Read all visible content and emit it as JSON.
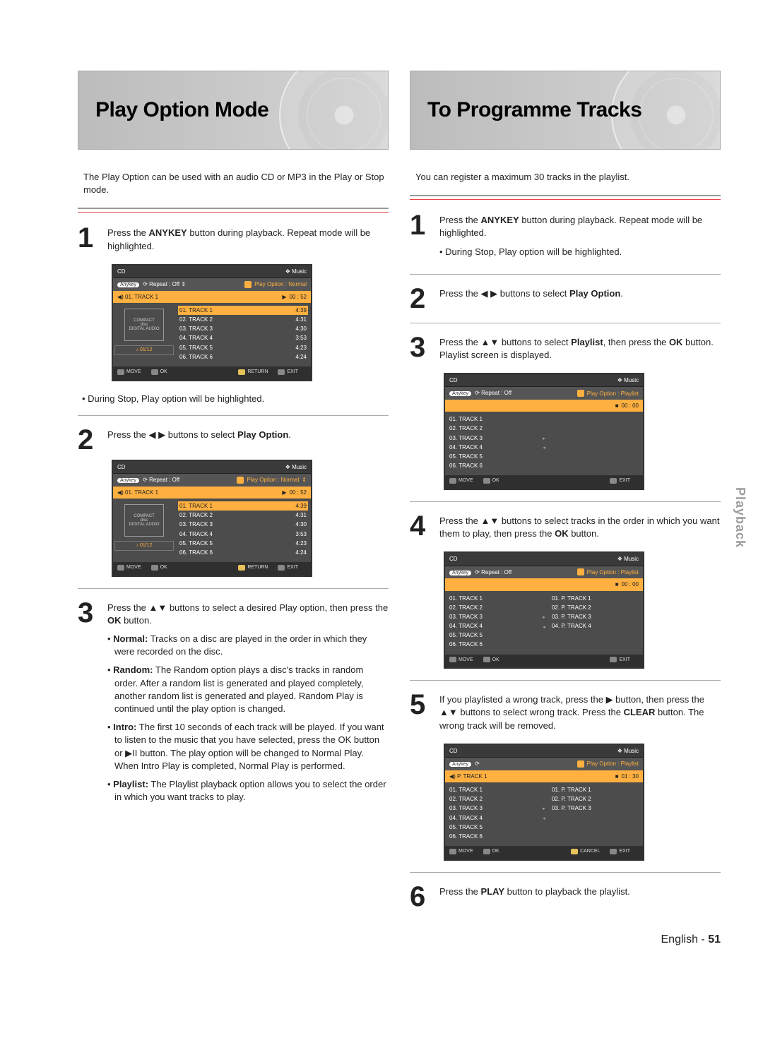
{
  "side_tab": "Playback",
  "footer": {
    "lang": "English -",
    "page": "51"
  },
  "left": {
    "title": "Play Option Mode",
    "intro": "The Play Option can be used with an audio CD or MP3 in the Play or Stop mode.",
    "step1": {
      "num": "1",
      "text_prefix": "Press the ",
      "anykey": "ANYKEY",
      "text_suffix": " button during playback. Repeat mode will be highlighted.",
      "note_prefix": "• During Stop, Play option will be highlighted."
    },
    "step2": {
      "num": "2",
      "text_prefix": "Press the ",
      "arrows": "◀ ▶",
      "text_mid": " buttons to select ",
      "playopt": "Play Option",
      "text_suffix": "."
    },
    "step3": {
      "num": "3",
      "text_prefix": "Press the ",
      "arrows": "▲▼",
      "text_mid": " buttons to select a desired Play option, then press the ",
      "ok": "OK",
      "text_suffix": " button.",
      "options": [
        {
          "name": "Normal:",
          "desc": "Tracks on a disc are played in the order in which they were recorded on the disc."
        },
        {
          "name": "Random:",
          "desc": "The Random option plays a disc's tracks in random order. After a random list is generated and played completely, another random list is generated and played. Random Play is continued until the play option is changed."
        },
        {
          "name": "Intro:",
          "desc": "The first 10 seconds of each track will be played. If you want to listen to the music that you have selected, press the OK button or ▶II button. The play option will be changed to Normal Play. When Intro Play is completed, Normal Play is performed."
        },
        {
          "name": "Playlist:",
          "desc": "The Playlist playback option allows you to select the order in which you want tracks to play."
        }
      ]
    },
    "ss_a": {
      "cd": "CD",
      "music": "❖ Music",
      "repeat_label": "Repeat : Off",
      "playopt": "Play Option : Normal",
      "now_track": "01. TRACK 1",
      "time": "00 : 52",
      "pager": "01/12",
      "tracks": [
        {
          "n": "01. TRACK 1",
          "t": "4:39"
        },
        {
          "n": "02. TRACK 2",
          "t": "4:31"
        },
        {
          "n": "03. TRACK 3",
          "t": "4:30"
        },
        {
          "n": "04. TRACK 4",
          "t": "3:53"
        },
        {
          "n": "05. TRACK 5",
          "t": "4:23"
        },
        {
          "n": "06. TRACK 6",
          "t": "4:24"
        }
      ],
      "f_move": "MOVE",
      "f_ok": "OK",
      "f_return": "RETURN",
      "f_exit": "EXIT"
    }
  },
  "right": {
    "title": "To Programme Tracks",
    "intro": "You can register a maximum 30 tracks in the playlist.",
    "step1": {
      "num": "1",
      "text_prefix": "Press the ",
      "anykey": "ANYKEY",
      "text_suffix": " button during playback. Repeat mode will be highlighted.",
      "note": "• During Stop, Play option will be highlighted."
    },
    "step2": {
      "num": "2",
      "text_prefix": "Press the ",
      "arrows": "◀ ▶",
      "text_mid": " buttons to select ",
      "playopt": "Play Option",
      "text_suffix": "."
    },
    "step3": {
      "num": "3",
      "text_prefix": "Press the ",
      "arrows": "▲▼",
      "text_mid": " buttons to select ",
      "playlist": "Playlist",
      "text_mid2": ", then press the ",
      "ok": "OK",
      "text_suffix": " button. Playlist screen is displayed."
    },
    "step4": {
      "num": "4",
      "text_prefix": "Press the ",
      "arrows": "▲▼",
      "text_mid": " buttons to select tracks in the order in which you want them to play, then press the ",
      "ok": "OK",
      "text_suffix": " button."
    },
    "step5": {
      "num": "5",
      "text_prefix": "If you playlisted a wrong track, press the ",
      "arrow_r": "▶",
      "text_mid": " button, then press the ",
      "arrows": "▲▼",
      "text_mid2": " buttons to select wrong track. Press the ",
      "clear": "CLEAR",
      "text_suffix": " button. The wrong track will be removed."
    },
    "step6": {
      "num": "6",
      "text_prefix": "Press the ",
      "play": "PLAY",
      "text_suffix": " button to playback the playlist."
    },
    "ss_b": {
      "cd": "CD",
      "music": "❖ Music",
      "repeat_label": "Repeat : Off",
      "playopt": "Play Option : Playlist",
      "time": "00 : 00",
      "tracks": [
        "01. TRACK 1",
        "02. TRACK 2",
        "03. TRACK 3",
        "04. TRACK 4",
        "05. TRACK 5",
        "06. TRACK 6"
      ],
      "f_move": "MOVE",
      "f_ok": "OK",
      "f_exit": "EXIT"
    },
    "ss_c": {
      "cd": "CD",
      "music": "❖ Music",
      "repeat_label": "Repeat : Off",
      "playopt": "Play Option : Playlist",
      "time": "00 : 00",
      "left": [
        "01. TRACK 1",
        "02. TRACK 2",
        "03. TRACK 3",
        "04. TRACK 4",
        "05. TRACK 5",
        "06. TRACK 6"
      ],
      "right": [
        "01. P. TRACK 1",
        "02. P. TRACK 2",
        "03. P. TRACK 3",
        "04. P. TRACK 4"
      ],
      "f_move": "MOVE",
      "f_ok": "OK",
      "f_exit": "EXIT"
    },
    "ss_d": {
      "cd": "CD",
      "music": "❖ Music",
      "playopt": "Play Option : Playlist",
      "now_track": "P. TRACK 1",
      "time": "01 : 30",
      "left": [
        "01. TRACK 1",
        "02. TRACK 2",
        "03. TRACK 3",
        "04. TRACK 4",
        "05. TRACK 5",
        "06. TRACK 6"
      ],
      "right": [
        "01. P. TRACK 1",
        "02. P. TRACK 2",
        "03. P.  TRACK 3"
      ],
      "f_move": "MOVE",
      "f_ok": "OK",
      "f_cancel": "CANCEL",
      "f_exit": "EXIT"
    }
  }
}
